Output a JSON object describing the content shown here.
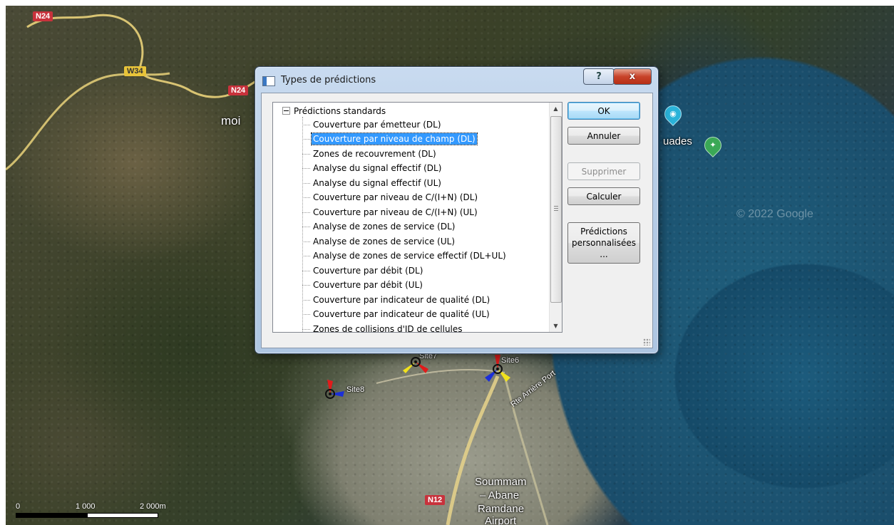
{
  "map": {
    "road_labels": [
      "N24",
      "W34",
      "N24",
      "N12"
    ],
    "place_labels": [
      "moi",
      "uades",
      "Soummam",
      "– Abane",
      "Ramdane",
      "Airport"
    ],
    "site_labels": [
      "Site7",
      "Site6",
      "Site8"
    ],
    "street_label": "Rte Arrière Port",
    "watermark": "© 2022 Google",
    "scale": [
      "0",
      "1 000",
      "2 000m"
    ]
  },
  "dialog": {
    "title": "Types de prédictions",
    "help_label": "?",
    "close_label": "x",
    "tree": {
      "root": "Prédictions standards",
      "items": [
        "Couverture par émetteur (DL)",
        "Couverture par niveau de champ (DL)",
        "Zones de recouvrement (DL)",
        "Analyse du signal effectif (DL)",
        "Analyse du signal effectif (UL)",
        "Couverture par niveau de C/(I+N) (DL)",
        "Couverture par niveau de C/(I+N) (UL)",
        "Analyse de zones de service (DL)",
        "Analyse de zones de service (UL)",
        "Analyse de zones de service effectif (DL+UL)",
        "Couverture par débit (DL)",
        "Couverture par débit (UL)",
        "Couverture par indicateur de qualité (DL)",
        "Couverture par indicateur de qualité (UL)",
        "Zones de collisions d'ID de cellules"
      ],
      "selected_index": 1
    },
    "buttons": {
      "ok": "OK",
      "cancel": "Annuler",
      "delete": "Supprimer",
      "compute": "Calculer",
      "custom_line1": "Prédictions",
      "custom_line2": "personnalisées",
      "custom_line3": "..."
    }
  }
}
